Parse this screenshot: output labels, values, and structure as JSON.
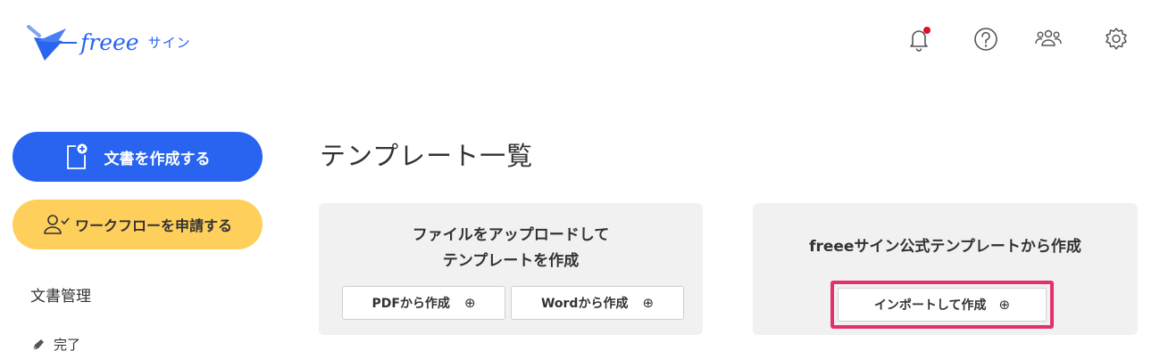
{
  "header": {
    "logo_text": "freee",
    "logo_sub": "サイン",
    "icons": [
      "bell-icon",
      "help-icon",
      "users-icon",
      "gear-icon"
    ],
    "notification_dot_color": "#e0102b"
  },
  "sidebar": {
    "create_label": "文書を作成する",
    "workflow_label": "ワークフローを申請する",
    "section_heading": "文書管理",
    "items": [
      {
        "label": "完了",
        "icon": "pen-icon"
      }
    ]
  },
  "main": {
    "title": "テンプレート一覧",
    "upload_card": {
      "line1": "ファイルをアップロードして",
      "line2": "テンプレートを作成",
      "pdf_label": "PDFから作成",
      "word_label": "Wordから作成",
      "plus": "⊕"
    },
    "template_card": {
      "description": "freeeサイン公式テンプレートから作成",
      "import_label": "インポートして作成",
      "plus": "⊕",
      "highlight_color": "#e3306f"
    }
  },
  "colors": {
    "primary": "#2864f0",
    "workflow": "#ffcf5c",
    "card_bg": "#f2f1f2"
  }
}
